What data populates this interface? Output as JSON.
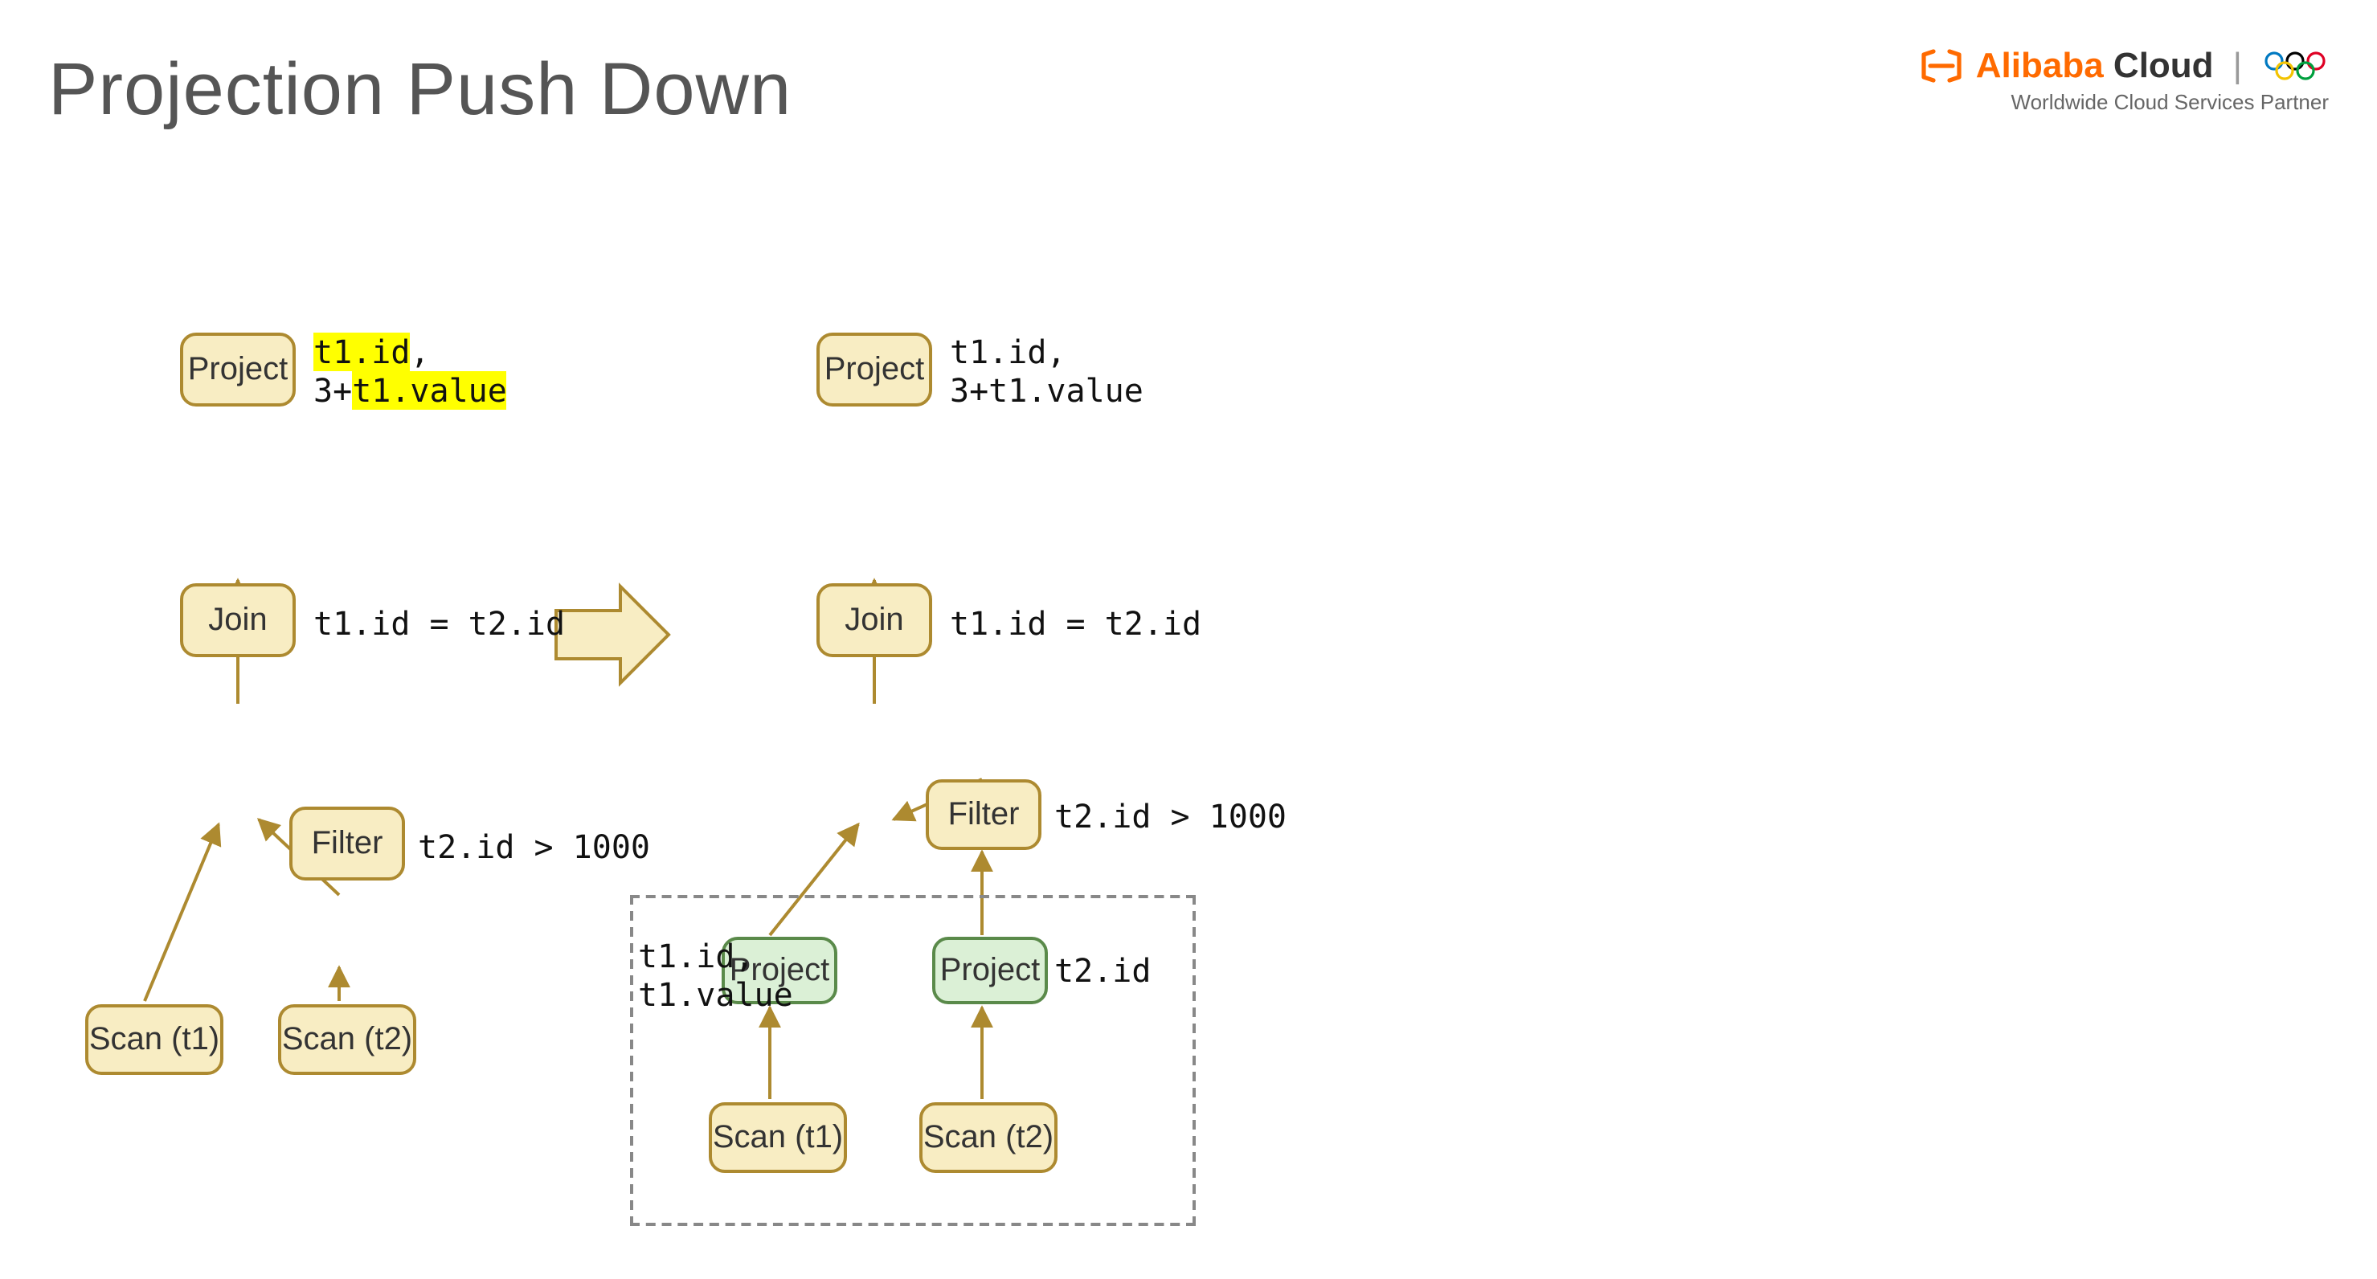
{
  "title": "Projection Push Down",
  "brand": {
    "name_prefix": "Alibaba",
    "name_suffix": " Cloud",
    "tagline": "Worldwide Cloud Services Partner"
  },
  "left": {
    "project": "Project",
    "project_annot_l1": "t1.id",
    "project_annot_l2_prefix": "3+",
    "project_annot_l2_hl": "t1.value",
    "join": "Join",
    "join_annot": "t1.id = t2.id",
    "filter": "Filter",
    "filter_annot": "t2.id > 1000",
    "scan_t1": "Scan (t1)",
    "scan_t2": "Scan (t2)"
  },
  "right": {
    "project": "Project",
    "project_annot": "t1.id,\n3+t1.value",
    "join": "Join",
    "join_annot": "t1.id = t2.id",
    "filter": "Filter",
    "filter_annot": "t2.id > 1000",
    "proj_t1": "Project",
    "proj_t1_annot": "t1.id,\nt1.value",
    "proj_t2": "Project",
    "proj_t2_annot": "t2.id",
    "scan_t1": "Scan (t1)",
    "scan_t2": "Scan (t2)"
  }
}
